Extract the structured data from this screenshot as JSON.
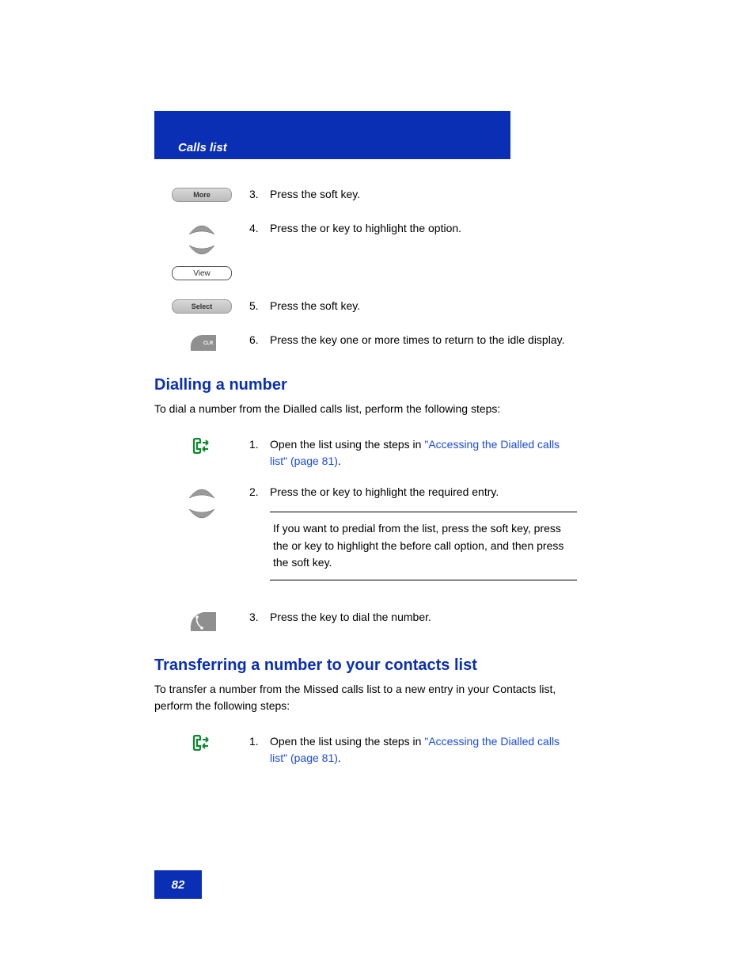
{
  "header": {
    "title": "Calls list"
  },
  "softkeys": {
    "more": "More",
    "view": "View",
    "select": "Select"
  },
  "section1": {
    "steps": [
      {
        "n": "3.",
        "text": "Press the            soft key."
      },
      {
        "n": "4.",
        "text": "Press the         or            key to highlight the            option."
      },
      {
        "n": "5.",
        "text": "Press the              soft key."
      },
      {
        "n": "6.",
        "text": "Press the         key one or more times to return to the idle display."
      }
    ]
  },
  "dialling": {
    "heading": "Dialling a number",
    "intro": "To dial a number from the Dialled calls list, perform the following steps:",
    "steps": [
      {
        "n": "1.",
        "text_a": "Open the                          list using the steps in ",
        "link": "\"Accessing the Dialled calls list\" (page 81)",
        "text_b": "."
      },
      {
        "n": "2.",
        "text": "Press the         or            key to highlight the required entry."
      },
      {
        "n": "3.",
        "text": "Press the          key to dial the number."
      }
    ],
    "tip": "              If you want to predial from the                       list, press the            soft key, press the         or            key to highlight the            before call option, and then press the              soft key."
  },
  "transfer": {
    "heading": "Transferring a number to your contacts list",
    "intro": "To transfer a number from the Missed calls list to a new entry in your Contacts list, perform the following steps:",
    "steps": [
      {
        "n": "1.",
        "text_a": "Open the                          list using the steps in ",
        "link": "\"Accessing the Dialled calls list\" (page 81)",
        "text_b": "."
      }
    ]
  },
  "page_number": "82"
}
